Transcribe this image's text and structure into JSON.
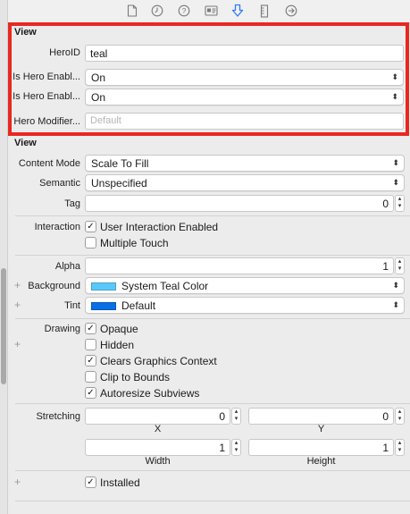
{
  "hero_section": {
    "title": "View",
    "hero_id_label": "HeroID",
    "hero_id_value": "teal",
    "is_hero_enabled_1_label": "Is Hero Enabl...",
    "is_hero_enabled_1_value": "On",
    "is_hero_enabled_2_label": "Is Hero Enabl...",
    "is_hero_enabled_2_value": "On",
    "hero_modifier_label": "Hero Modifier...",
    "hero_modifier_placeholder": "Default"
  },
  "view_section": {
    "title": "View",
    "content_mode_label": "Content Mode",
    "content_mode_value": "Scale To Fill",
    "semantic_label": "Semantic",
    "semantic_value": "Unspecified",
    "tag_label": "Tag",
    "tag_value": "0",
    "interaction_label": "Interaction",
    "user_interaction_label": "User Interaction Enabled",
    "user_interaction_checked": true,
    "multiple_touch_label": "Multiple Touch",
    "multiple_touch_checked": false,
    "alpha_label": "Alpha",
    "alpha_value": "1",
    "background_label": "Background",
    "background_value": "System Teal Color",
    "background_color": "#5ac8fa",
    "tint_label": "Tint",
    "tint_value": "Default",
    "tint_color": "#0a6fe6",
    "drawing_label": "Drawing",
    "opaque_label": "Opaque",
    "opaque_checked": true,
    "hidden_label": "Hidden",
    "hidden_checked": false,
    "clears_context_label": "Clears Graphics Context",
    "clears_context_checked": true,
    "clip_bounds_label": "Clip to Bounds",
    "clip_bounds_checked": false,
    "autoresize_label": "Autoresize Subviews",
    "autoresize_checked": true,
    "stretching_label": "Stretching",
    "stretch_x_value": "0",
    "stretch_y_value": "0",
    "stretch_width_value": "1",
    "stretch_height_value": "1",
    "x_label": "X",
    "y_label": "Y",
    "width_label": "Width",
    "height_label": "Height",
    "installed_label": "Installed",
    "installed_checked": true
  },
  "toolbar": {
    "icons": [
      "file-icon",
      "clock-icon",
      "help-icon",
      "identity-card-icon",
      "attributes-icon",
      "ruler-icon",
      "connections-icon"
    ]
  },
  "glyphs": {
    "check": "✓",
    "updown": "⌃⌄",
    "plus": "+"
  },
  "accent_color": "#2f7cf6",
  "highlight_color": "#e8281f"
}
